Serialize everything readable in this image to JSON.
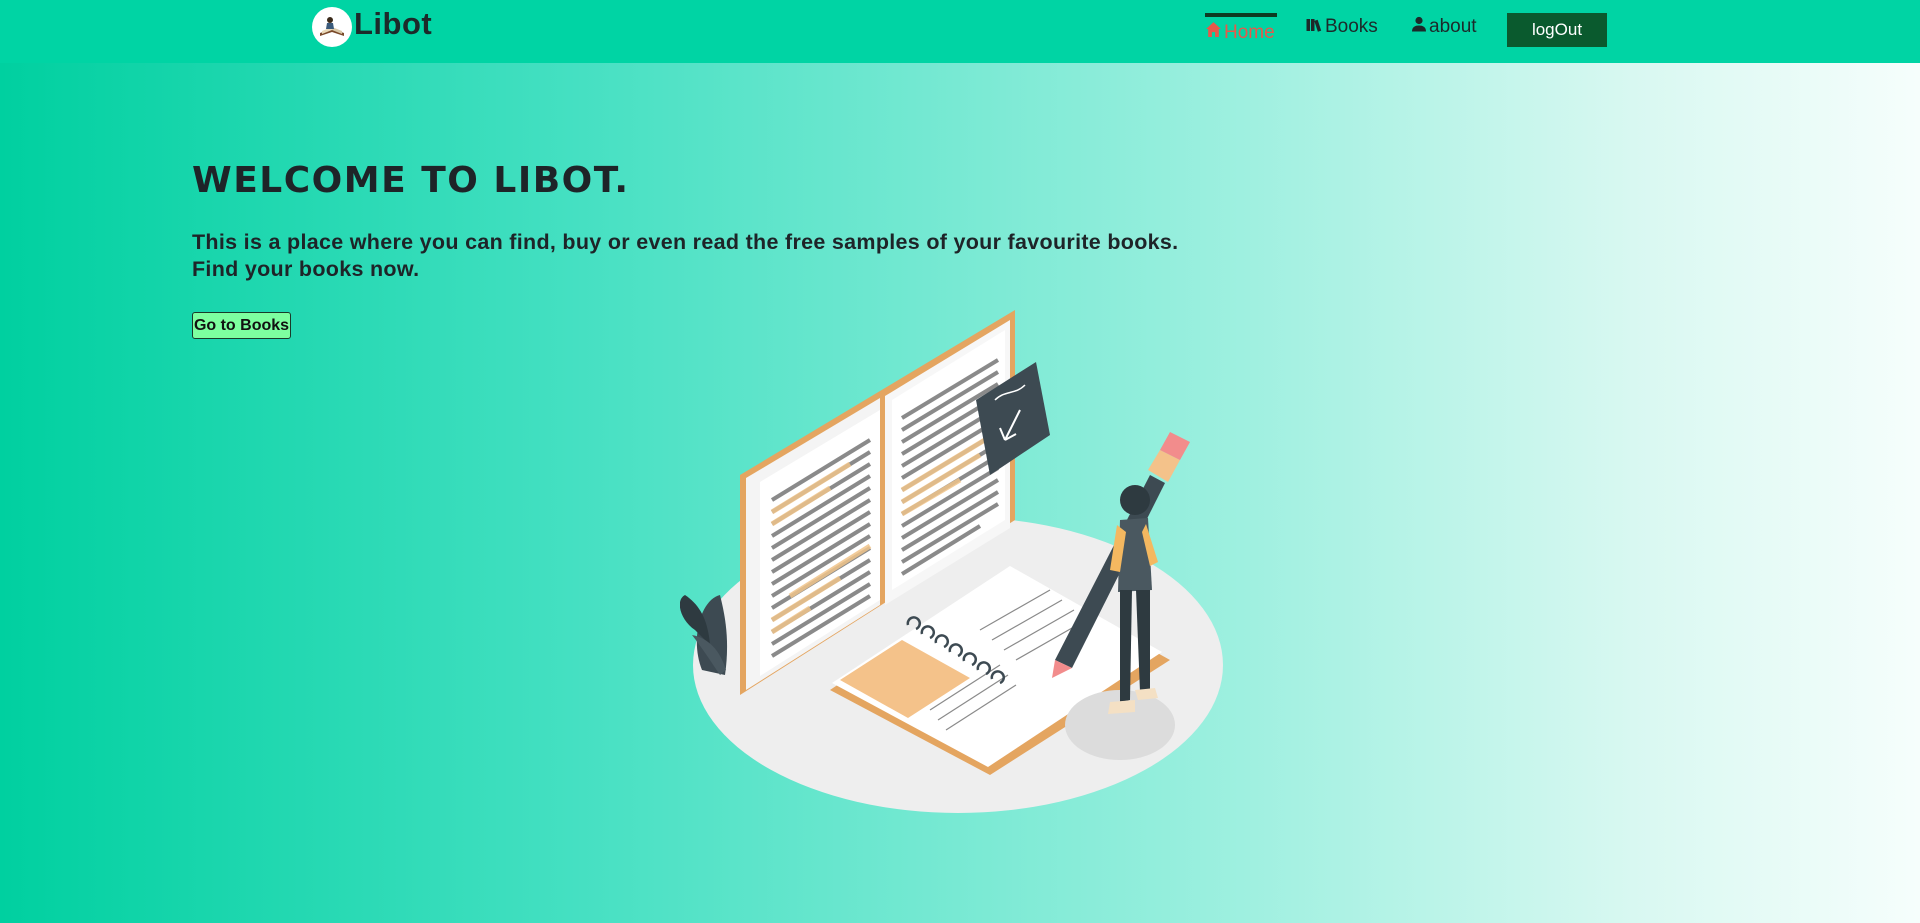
{
  "navbar": {
    "brand_name": "Libot",
    "logo_icon": "book-reading-logo-icon",
    "items": [
      {
        "label": "Home",
        "icon": "home-icon",
        "active": true
      },
      {
        "label": "Books",
        "icon": "books-icon",
        "active": false
      },
      {
        "label": "about",
        "icon": "user-icon",
        "active": false
      }
    ],
    "logout_label": "logOut"
  },
  "hero": {
    "title": "WELCOME TO LIBOT.",
    "description_line1": "This is a place where you can find, buy or even read the free samples of your favourite books.",
    "description_line2": "Find your books now.",
    "cta_label": "Go to Books"
  },
  "colors": {
    "navbar_bg": "#00d4a4",
    "active_nav": "#e8584a",
    "logout_bg": "#0a5a2e",
    "cta_bg": "#7dffa0"
  }
}
